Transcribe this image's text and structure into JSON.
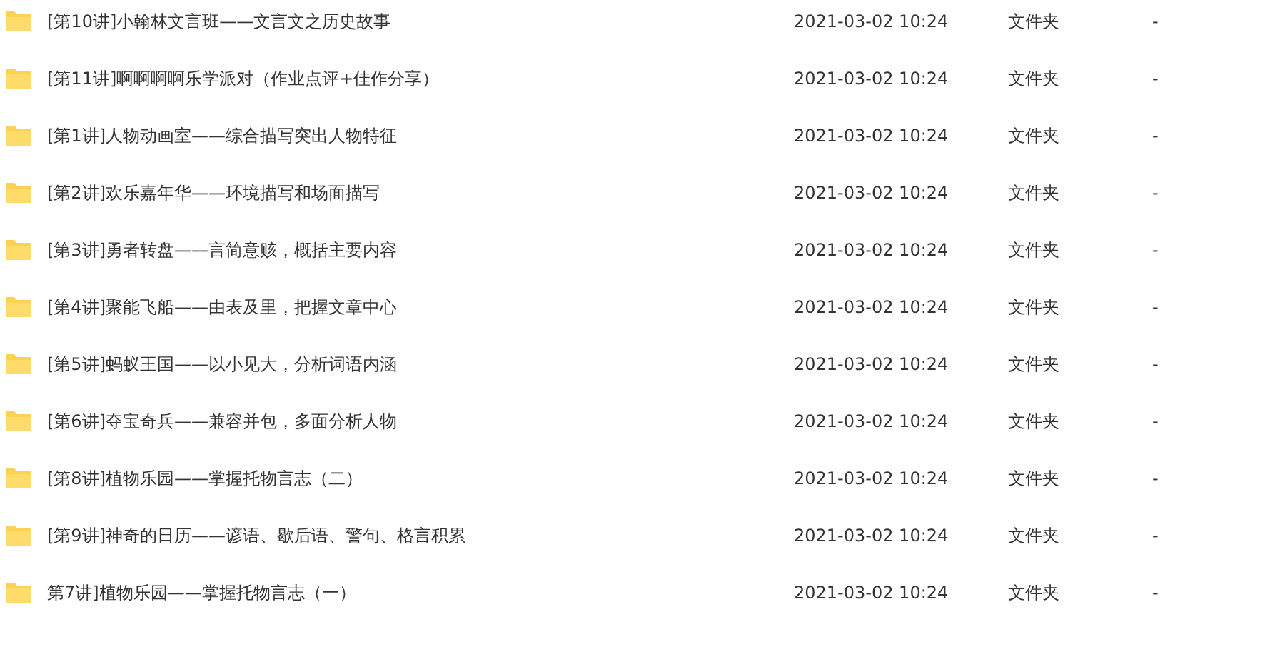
{
  "files": [
    {
      "name": "[第10讲]小翰林文言班——文言文之历史故事",
      "modified": "2021-03-02 10:24",
      "type": "文件夹",
      "size": "-"
    },
    {
      "name": "[第11讲]啊啊啊啊乐学派对（作业点评+佳作分享）",
      "modified": "2021-03-02 10:24",
      "type": "文件夹",
      "size": "-"
    },
    {
      "name": "[第1讲]人物动画室——综合描写突出人物特征",
      "modified": "2021-03-02 10:24",
      "type": "文件夹",
      "size": "-"
    },
    {
      "name": "[第2讲]欢乐嘉年华——环境描写和场面描写",
      "modified": "2021-03-02 10:24",
      "type": "文件夹",
      "size": "-"
    },
    {
      "name": "[第3讲]勇者转盘——言简意赅，概括主要内容",
      "modified": "2021-03-02 10:24",
      "type": "文件夹",
      "size": "-"
    },
    {
      "name": "[第4讲]聚能飞船——由表及里，把握文章中心",
      "modified": "2021-03-02 10:24",
      "type": "文件夹",
      "size": "-"
    },
    {
      "name": "[第5讲]蚂蚁王国——以小见大，分析词语内涵",
      "modified": "2021-03-02 10:24",
      "type": "文件夹",
      "size": "-"
    },
    {
      "name": "[第6讲]夺宝奇兵——兼容并包，多面分析人物",
      "modified": "2021-03-02 10:24",
      "type": "文件夹",
      "size": "-"
    },
    {
      "name": "[第8讲]植物乐园——掌握托物言志（二）",
      "modified": "2021-03-02 10:24",
      "type": "文件夹",
      "size": "-"
    },
    {
      "name": "[第9讲]神奇的日历——谚语、歇后语、警句、格言积累",
      "modified": "2021-03-02 10:24",
      "type": "文件夹",
      "size": "-"
    },
    {
      "name": "第7讲]植物乐园——掌握托物言志（一）",
      "modified": "2021-03-02 10:24",
      "type": "文件夹",
      "size": "-"
    }
  ]
}
